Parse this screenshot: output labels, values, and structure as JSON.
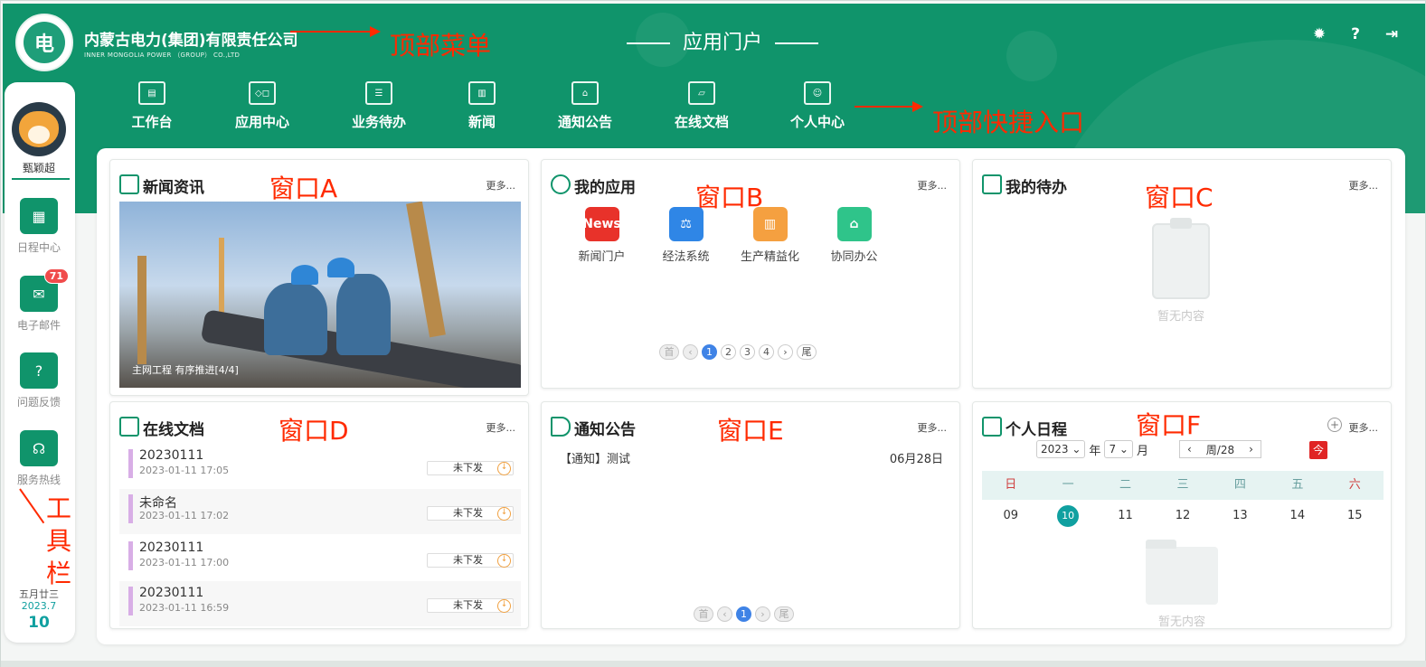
{
  "header": {
    "company_name": "内蒙古电力(集团)有限责任公司",
    "company_en": "INNER MONGOLIA POWER （GROUP） CO.,LTD",
    "portal_title": "应用门户",
    "icons": [
      "gear-icon",
      "help-icon",
      "logout-icon"
    ]
  },
  "annotations": {
    "top_menu": "顶部菜单",
    "quick_entry": "顶部快捷入口",
    "toolbar": "工具栏",
    "toolbar_lines": [
      "工",
      "具",
      "栏"
    ],
    "win_a": "窗口A",
    "win_b": "窗口B",
    "win_c": "窗口C",
    "win_d": "窗口D",
    "win_e": "窗口E",
    "win_f": "窗口F"
  },
  "nav": {
    "items": [
      {
        "label": "工作台",
        "icon": "dashboard-icon"
      },
      {
        "label": "应用中心",
        "icon": "apps-icon"
      },
      {
        "label": "业务待办",
        "icon": "tasks-icon"
      },
      {
        "label": "新闻",
        "icon": "news-icon"
      },
      {
        "label": "通知公告",
        "icon": "notice-icon"
      },
      {
        "label": "在线文档",
        "icon": "folder-icon"
      },
      {
        "label": "个人中心",
        "icon": "profile-icon"
      }
    ]
  },
  "sidebar": {
    "username": "甄颖超",
    "tools": [
      {
        "label": "日程中心",
        "icon": "calendar-icon"
      },
      {
        "label": "电子邮件",
        "icon": "mail-icon",
        "badge": "71"
      },
      {
        "label": "问题反馈",
        "icon": "feedback-icon"
      },
      {
        "label": "服务热线",
        "icon": "headset-icon"
      }
    ],
    "lunar": "五月廿三",
    "year_month": "2023.7",
    "day": "10"
  },
  "windows": {
    "news": {
      "title": "新闻资讯",
      "more": "更多...",
      "caption": "主网工程 有序推进[4/4]"
    },
    "apps": {
      "title": "我的应用",
      "more": "更多...",
      "items": [
        {
          "label": "新闻门户",
          "icon_text": "News",
          "color": "#e8322a"
        },
        {
          "label": "经法系统",
          "icon_text": "⚖",
          "color": "#2f86e6"
        },
        {
          "label": "生产精益化",
          "icon_text": "▥",
          "color": "#f5a040"
        },
        {
          "label": "协同办公",
          "icon_text": "⌂",
          "color": "#2fc48a"
        }
      ],
      "pager": [
        "首",
        "‹",
        "1",
        "2",
        "3",
        "4",
        "›",
        "尾"
      ]
    },
    "todo": {
      "title": "我的待办",
      "more": "更多...",
      "empty": "暂无内容"
    },
    "docs": {
      "title": "在线文档",
      "more": "更多...",
      "rows": [
        {
          "name": "20230111",
          "time": "2023-01-11 17:05",
          "status": "未下发"
        },
        {
          "name": "未命名",
          "time": "2023-01-11 17:02",
          "status": "未下发"
        },
        {
          "name": "20230111",
          "time": "2023-01-11 17:00",
          "status": "未下发"
        },
        {
          "name": "20230111",
          "time": "2023-01-11 16:59",
          "status": "未下发"
        }
      ]
    },
    "notice": {
      "title": "通知公告",
      "more": "更多...",
      "items": [
        {
          "text": "【通知】测试",
          "date": "06月28日"
        }
      ],
      "pager": [
        "首",
        "‹",
        "1",
        "›",
        "尾"
      ]
    },
    "schedule": {
      "title": "个人日程",
      "more": "更多...",
      "year": "2023",
      "year_suffix": "年",
      "month": "7",
      "month_suffix": "月",
      "week": "周/28",
      "today_btn": "今",
      "weekdays": [
        "日",
        "一",
        "二",
        "三",
        "四",
        "五",
        "六"
      ],
      "days": [
        "09",
        "10",
        "11",
        "12",
        "13",
        "14",
        "15"
      ],
      "today_index": 1,
      "empty": "暂无内容"
    }
  }
}
